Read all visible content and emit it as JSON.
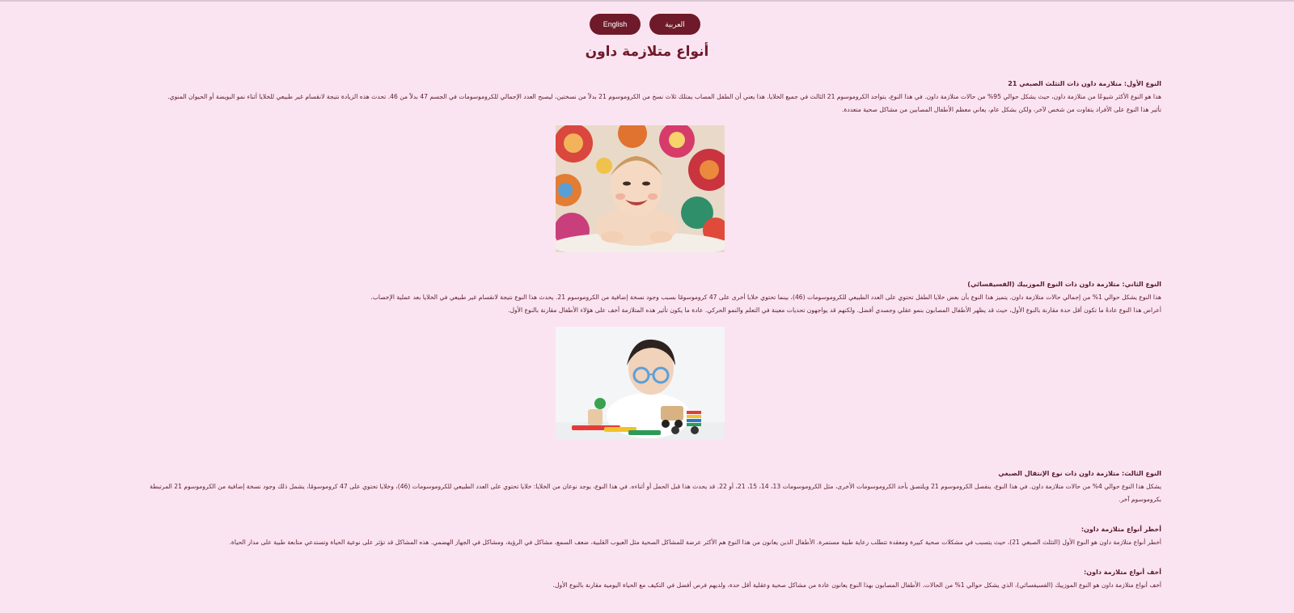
{
  "language_buttons": {
    "arabic": "العربية",
    "english": "English"
  },
  "title": "أنواع متلازمة داون",
  "sections": [
    {
      "heading": "النوع الأول: متلازمة داون ذات التثلث الصبغي 21",
      "paragraphs": [
        "هذا هو النوع الأكثر شيوعًا من متلازمة داون، حيث يشكل حوالي 95% من حالات متلازمة داون. في هذا النوع، يتواجد الكروموسوم 21 الثالث في جميع الخلايا. هذا يعني أن الطفل المصاب يمتلك ثلاث نسخ من الكروموسوم 21 بدلاً من نسختين، ليصبح العدد الإجمالي للكروموسومات في الجسم 47 بدلاً من 46. تحدث هذه الزيادة نتيجة لانقسام غير طبيعي للخلايا أثناء نمو البويضة أو الحيوان المنوي.",
        "تأثير هذا النوع على الأفراد يتفاوت من شخص لآخر، ولكن بشكل عام، يعاني معظم الأطفال المصابين من مشاكل صحية متعددة."
      ]
    },
    {
      "heading": "النوع الثاني: متلازمة داون ذات النوع الموزييك (الفسيفسائي)",
      "paragraphs": [
        "هذا النوع يشكل حوالي 1% من إجمالي حالات متلازمة داون. يتميز هذا النوع بأن بعض خلايا الطفل تحتوي على العدد الطبيعي للكروموسومات (46)، بينما تحتوي خلايا أخرى على 47 كروموسومًا بسبب وجود نسخة إضافية من الكروموسوم 21. يحدث هذا النوع نتيجة لانقسام غير طبيعي في الخلايا بعد عملية الإخصاب.",
        "أعراض هذا النوع عادةً ما تكون أقل حدة مقارنة بالنوع الأول، حيث قد يظهر الأطفال المصابون بنمو عقلي وجسدي أفضل. ولكنهم قد يواجهون تحديات معينة في التعلم والنمو الحركي. عادة ما يكون تأثير هذه المتلازمة أخف على هؤلاء الأطفال مقارنة بالنوع الأول."
      ]
    },
    {
      "heading": "النوع الثالث: متلازمة داون ذات نوع الإنتقال الصبغي",
      "paragraphs": [
        "يشكل هذا النوع حوالي 4% من حالات متلازمة داون. في هذا النوع، ينفصل الكروموسوم 21 ويلتصق بأحد الكروموسومات الأخرى، مثل الكروموسومات 13، 14، 15، 21، أو 22. قد يحدث هذا قبل الحمل أو أثناءه. في هذا النوع، يوجد نوعان من الخلايا: خلايا تحتوي على العدد الطبيعي للكروموسومات (46)، وخلايا تحتوي على 47 كروموسومًا، يشمل ذلك وجود نسخة إضافية من الكروموسوم 21 المرتبطة بكروموسوم آخر."
      ]
    },
    {
      "heading": "أخطر أنواع متلازمة داون:",
      "paragraphs": [
        "أخطر أنواع متلازمة داون هو النوع الأول (التثلث الصبغي 21)، حيث يتسبب في مشكلات صحية كبيرة ومعقدة تتطلب رعاية طبية مستمرة. الأطفال الذين يعانون من هذا النوع هم الأكثر عرضة للمشاكل الصحية مثل العيوب القلبية، ضعف السمع، مشاكل في الرؤية، ومشاكل في الجهاز الهضمي. هذه المشاكل قد تؤثر على نوعية الحياة وتستدعي متابعة طبية على مدار الحياة."
      ]
    },
    {
      "heading": "أخف أنواع متلازمة داون:",
      "paragraphs": [
        "أخف أنواع متلازمة داون هو النوع الموزييك (الفسيفسائي)، الذي يشكل حوالي 1% من الحالات. الأطفال المصابون بهذا النوع يعانون عادة من مشاكل صحية وعقلية أقل حدة، ولديهم فرص أفضل في التكيف مع الحياة اليومية مقارنة بالنوع الأول."
      ]
    }
  ],
  "images": [
    {
      "subject": "smiling baby photo"
    },
    {
      "subject": "child with glasses playing with toys photo"
    }
  ]
}
